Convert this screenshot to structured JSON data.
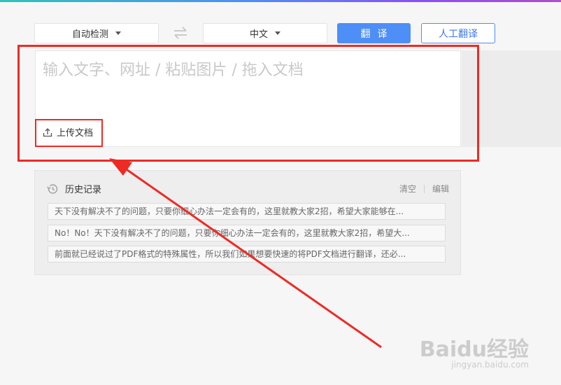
{
  "toolbar": {
    "source_language": "自动检测",
    "target_language": "中文",
    "translate_label": "翻译",
    "human_translate_label": "人工翻译"
  },
  "input": {
    "placeholder": "输入文字、网址 / 粘贴图片 / 拖入文档",
    "upload_label": "上传文档"
  },
  "history": {
    "title": "历史记录",
    "clear_label": "清空",
    "edit_label": "编辑",
    "items": [
      "天下没有解决不了的问题，只要你细心办法一定会有的，这里就教大家2招，希望大家能够在...",
      "No！No！天下没有解决不了的问题，只要你细心办法一定会有的，这里就教大家2招，希望大...",
      "前面就已经说过了PDF格式的特殊属性，所以我们如果想要快速的将PDF文档进行翻译，还必..."
    ]
  },
  "watermark": {
    "main": "Baidu经验",
    "sub": "jingyan.baidu.com"
  },
  "colors": {
    "accent": "#4e8ef7",
    "highlight": "#ee2a24",
    "background": "#f6f6f6"
  },
  "icons": [
    "swap-icon",
    "chevron-down-icon",
    "upload-icon",
    "history-clock-icon"
  ]
}
